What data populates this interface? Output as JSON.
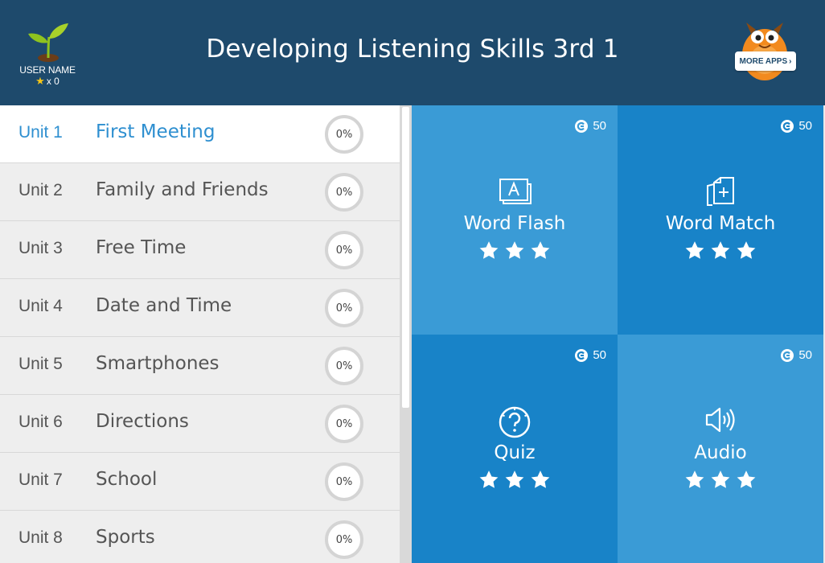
{
  "header": {
    "title": "Developing Listening Skills 3rd 1",
    "user_name": "USER NAME",
    "star_count": "x 0",
    "more_apps_label": "MORE APPS"
  },
  "units": [
    {
      "num": "Unit 1",
      "title": "First Meeting",
      "progress": "0%",
      "active": true
    },
    {
      "num": "Unit 2",
      "title": "Family and Friends",
      "progress": "0%"
    },
    {
      "num": "Unit 3",
      "title": "Free Time",
      "progress": "0%"
    },
    {
      "num": "Unit 4",
      "title": "Date and Time",
      "progress": "0%"
    },
    {
      "num": "Unit 5",
      "title": "Smartphones",
      "progress": "0%"
    },
    {
      "num": "Unit 6",
      "title": "Directions",
      "progress": "0%"
    },
    {
      "num": "Unit 7",
      "title": "School",
      "progress": "0%"
    },
    {
      "num": "Unit 8",
      "title": "Sports",
      "progress": "0%"
    }
  ],
  "activities": [
    {
      "label": "Word Flash",
      "coins": "50",
      "icon": "word-flash-icon",
      "stars": 3
    },
    {
      "label": "Word Match",
      "coins": "50",
      "icon": "word-match-icon",
      "stars": 3
    },
    {
      "label": "Quiz",
      "coins": "50",
      "icon": "quiz-icon",
      "stars": 3
    },
    {
      "label": "Audio",
      "coins": "50",
      "icon": "audio-icon",
      "stars": 3
    }
  ],
  "colors": {
    "header_bg": "#1e4a6c",
    "active_text": "#2e8fd0",
    "tile_light": "#3a9bd6",
    "tile_dark": "#1883c8"
  }
}
